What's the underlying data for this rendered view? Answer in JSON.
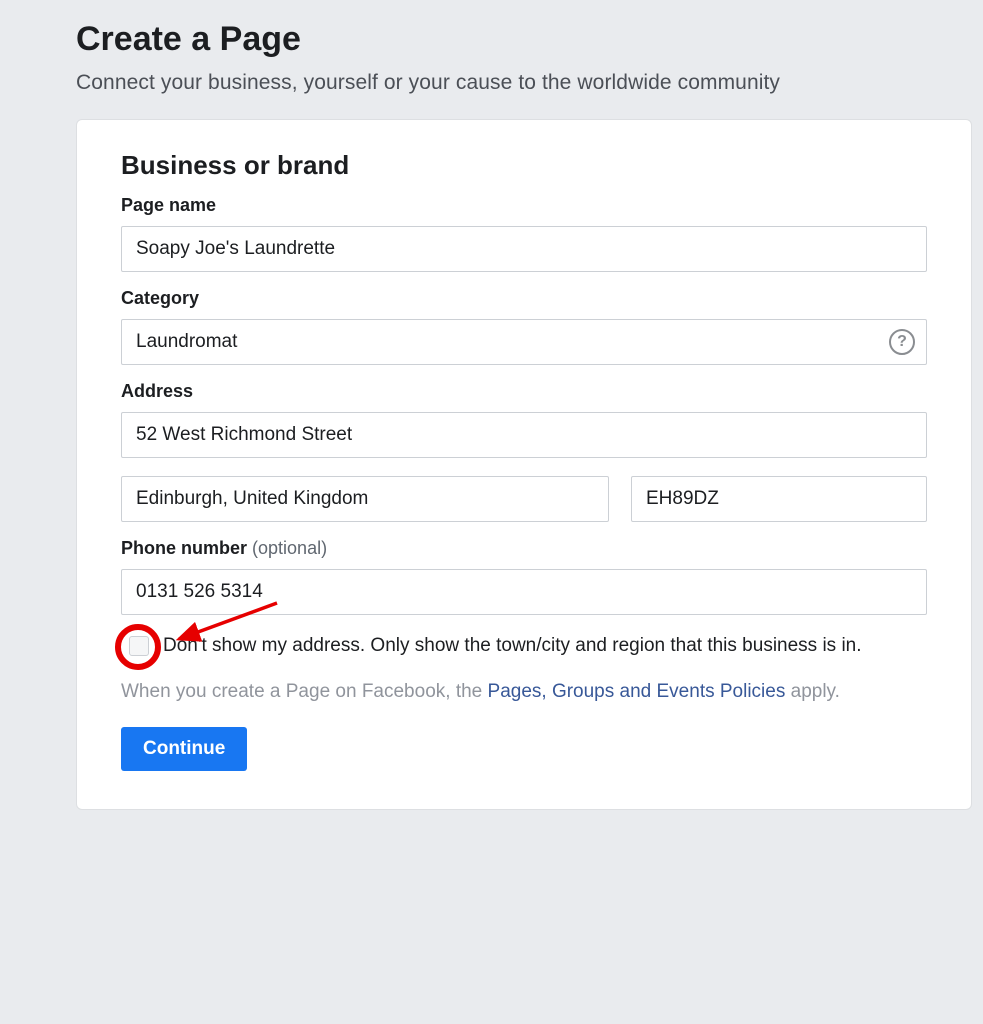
{
  "header": {
    "title": "Create a Page",
    "subtitle": "Connect your business, yourself or your cause to the worldwide community"
  },
  "card": {
    "title": "Business or brand",
    "page_name": {
      "label": "Page name",
      "value": "Soapy Joe's Laundrette"
    },
    "category": {
      "label": "Category",
      "value": "Laundromat"
    },
    "address": {
      "label": "Address",
      "street": "52 West Richmond Street",
      "city": "Edinburgh, United Kingdom",
      "postcode": "EH89DZ"
    },
    "phone": {
      "label": "Phone number",
      "optional_text": "(optional)",
      "value": "0131 526 5314"
    },
    "hide_address_checkbox": {
      "checked": false,
      "label": "Don't show my address. Only show the town/city and region that this business is in."
    },
    "policy": {
      "prefix": "When you create a Page on Facebook, the ",
      "link_text": "Pages, Groups and Events Policies",
      "suffix": " apply."
    },
    "continue_label": "Continue"
  }
}
